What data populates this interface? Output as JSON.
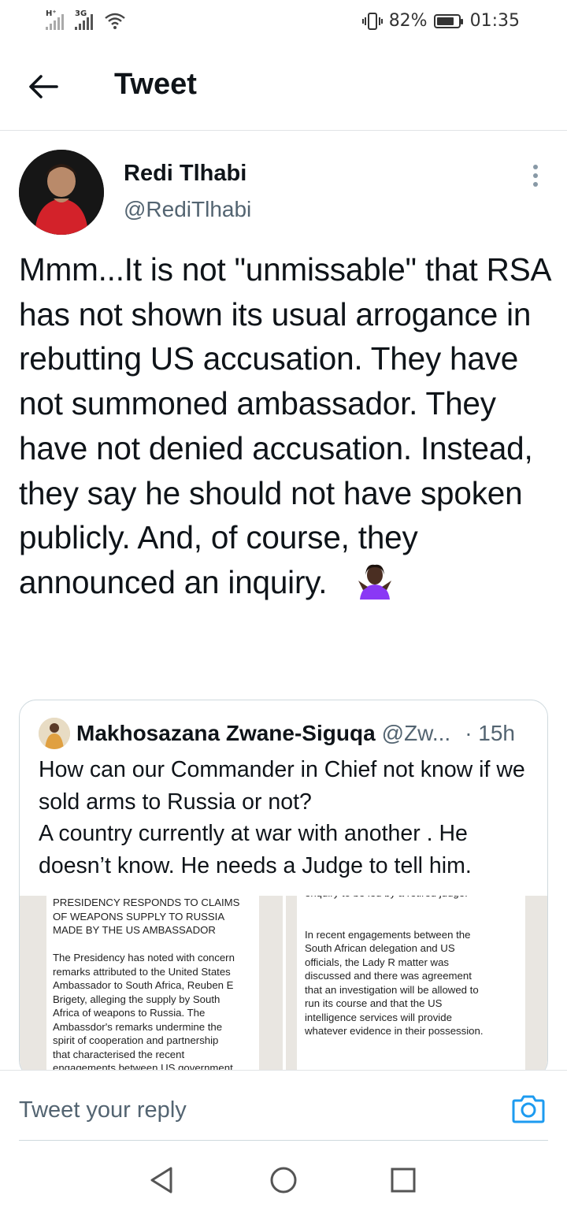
{
  "status_bar": {
    "signal1_label": "H⁺",
    "signal2_label": "3G",
    "battery_percent": "82%",
    "battery_level": 0.82,
    "time": "01:35"
  },
  "header": {
    "title": "Tweet"
  },
  "tweet": {
    "author_name": "Redi Tlhabi",
    "author_handle": "@RediTlhabi",
    "text": "Mmm...It is not \"unmissable\" that RSA has not shown its usual arrogance in rebutting US accusation. They have not summoned ambassador.  They have not denied accusation. Instead, they say he should not have spoken publicly. And, of course, they announced an inquiry.",
    "emoji": "shrug-emoji"
  },
  "quoted_tweet": {
    "author_name": "Makhosazana Zwane-Siguqa",
    "author_handle": "@Zw...",
    "time": "· 15h",
    "text": "How can our Commander in Chief not know if we sold arms to Russia or not?\nA country currently at war with another . He doesn’t know. He needs a Judge to tell him.",
    "image_left_text": "PRESIDENCY RESPONDS TO CLAIMS\nOF WEAPONS SUPPLY TO RUSSIA\nMADE BY THE US AMBASSADOR\n\nThe Presidency has noted with concern\nremarks attributed to the United States\nAmbassador to South Africa, Reuben E\nBrigety, alleging the supply by South\nAfrica of weapons to Russia.  The\nAmbassdor's remarks undermine the\nspirit of cooperation and partnership\nthat characterised the recent\nengagements between US government",
    "image_right_text": "enquiry to be led by a retired judge.\n\n\nIn recent engagements between the\nSouth African delegation and US\nofficials, the Lady R matter was\ndiscussed and there was agreement\nthat an investigation will be allowed to\nrun its course and that the US\nintelligence services will provide\nwhatever evidence in their possession."
  },
  "reply": {
    "placeholder": "Tweet your reply"
  },
  "colors": {
    "accent": "#1d9bf0",
    "secondary_text": "#536471",
    "border": "#cfd9de"
  },
  "icons": {
    "back": "arrow-left-icon",
    "more": "more-vertical-icon",
    "camera": "camera-icon",
    "nav_back": "triangle-back-icon",
    "nav_home": "circle-home-icon",
    "nav_recent": "square-recent-icon"
  }
}
